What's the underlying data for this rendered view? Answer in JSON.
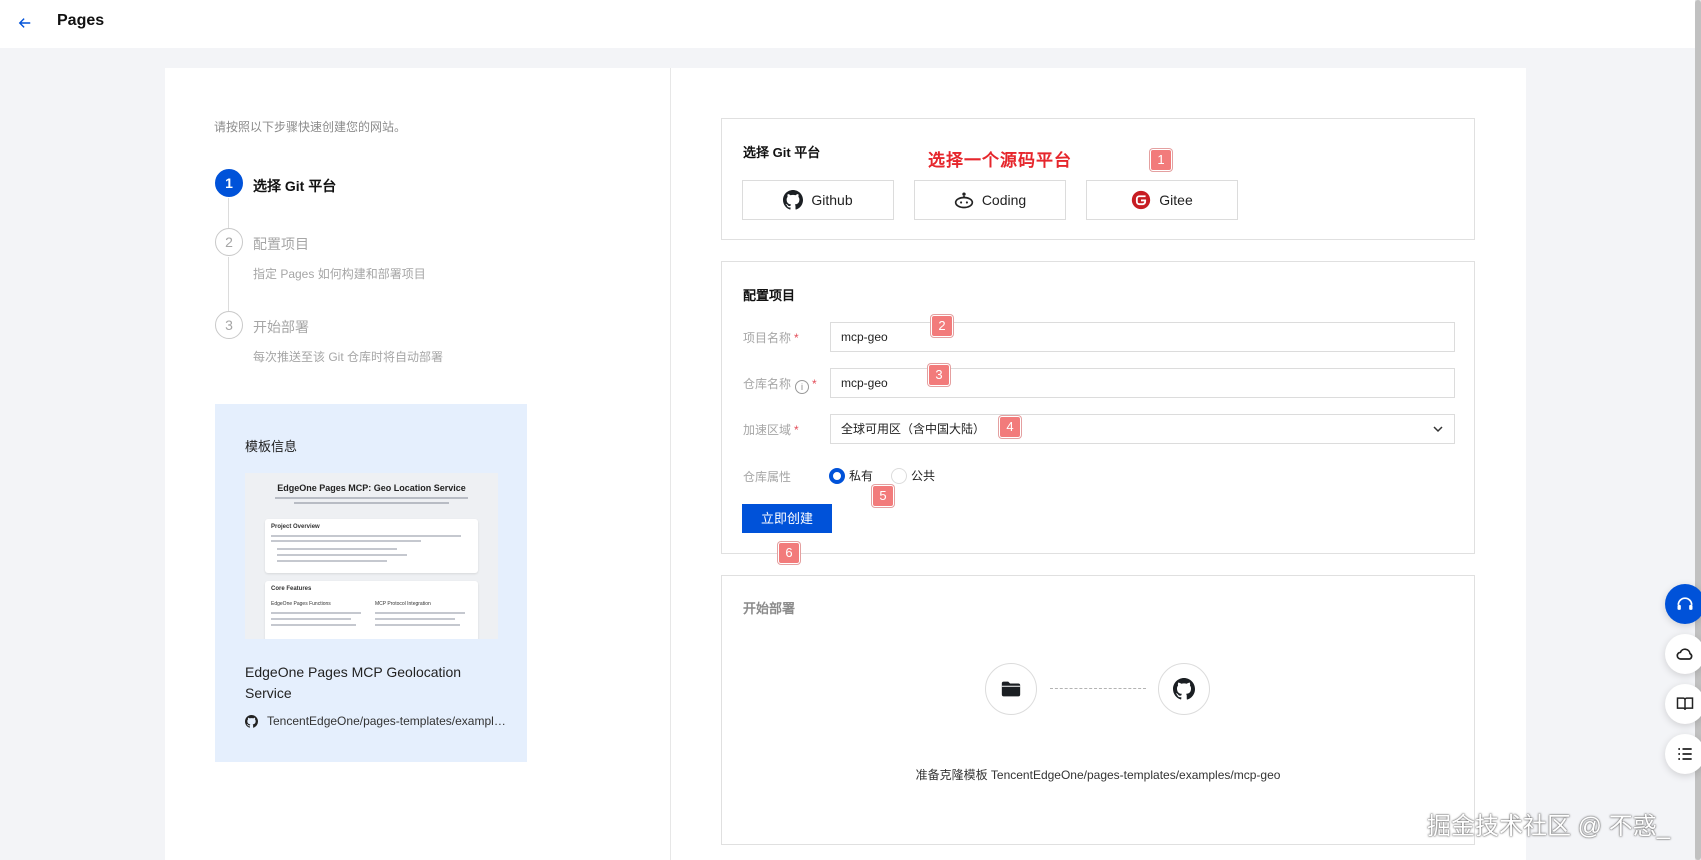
{
  "header": {
    "title": "Pages",
    "back_icon": "arrow-left-icon"
  },
  "intro": "请按照以下步骤快速创建您的网站。",
  "steps": [
    {
      "number": "1",
      "title": "选择 Git 平台",
      "desc": "",
      "state": "active"
    },
    {
      "number": "2",
      "title": "配置项目",
      "desc": "指定 Pages 如何构建和部署项目",
      "state": "inactive"
    },
    {
      "number": "3",
      "title": "开始部署",
      "desc": "每次推送至该 Git 仓库时将自动部署",
      "state": "inactive"
    }
  ],
  "template": {
    "heading": "模板信息",
    "preview_title": "EdgeOne Pages MCP: Geo Location Service",
    "preview_section_1": "Project Overview",
    "preview_section_2": "Core Features",
    "preview_col_1": "EdgeOne Pages Functions",
    "preview_col_2": "MCP Protocol Integration",
    "name": "EdgeOne Pages MCP Geolocation Service",
    "repo": "TencentEdgeOne/pages-templates/examples/mcp-geo"
  },
  "git_section": {
    "title": "选择 Git 平台",
    "annotation": "选择一个源码平台",
    "platforms": [
      {
        "label": "Github",
        "icon": "github-icon"
      },
      {
        "label": "Coding",
        "icon": "coding-icon"
      },
      {
        "label": "Gitee",
        "icon": "gitee-icon"
      }
    ]
  },
  "config_section": {
    "title": "配置项目",
    "project_name_label": "项目名称",
    "project_name_value": "mcp-geo",
    "repo_name_label": "仓库名称",
    "repo_name_value": "mcp-geo",
    "region_label": "加速区域",
    "region_value": "全球可用区（含中国大陆）",
    "visibility_label": "仓库属性",
    "visibility_private": "私有",
    "visibility_public": "公共",
    "visibility_selected": "私有",
    "submit_label": "立即创建",
    "required_mark": "*",
    "info_mark": "i"
  },
  "deploy_section": {
    "title": "开始部署",
    "status_text": "准备克隆模板 TencentEdgeOne/pages-templates/examples/mcp-geo"
  },
  "annotations": [
    "1",
    "2",
    "3",
    "4",
    "5",
    "6"
  ],
  "float_buttons": [
    "headset-icon",
    "cloud-icon",
    "book-icon",
    "list-icon"
  ],
  "watermark": "掘金技术社区 @ 不惑_",
  "colors": {
    "primary": "#0052d9",
    "annotation": "#f27b7b",
    "annotation_text": "#e6262c",
    "template_bg": "#e5effd"
  }
}
